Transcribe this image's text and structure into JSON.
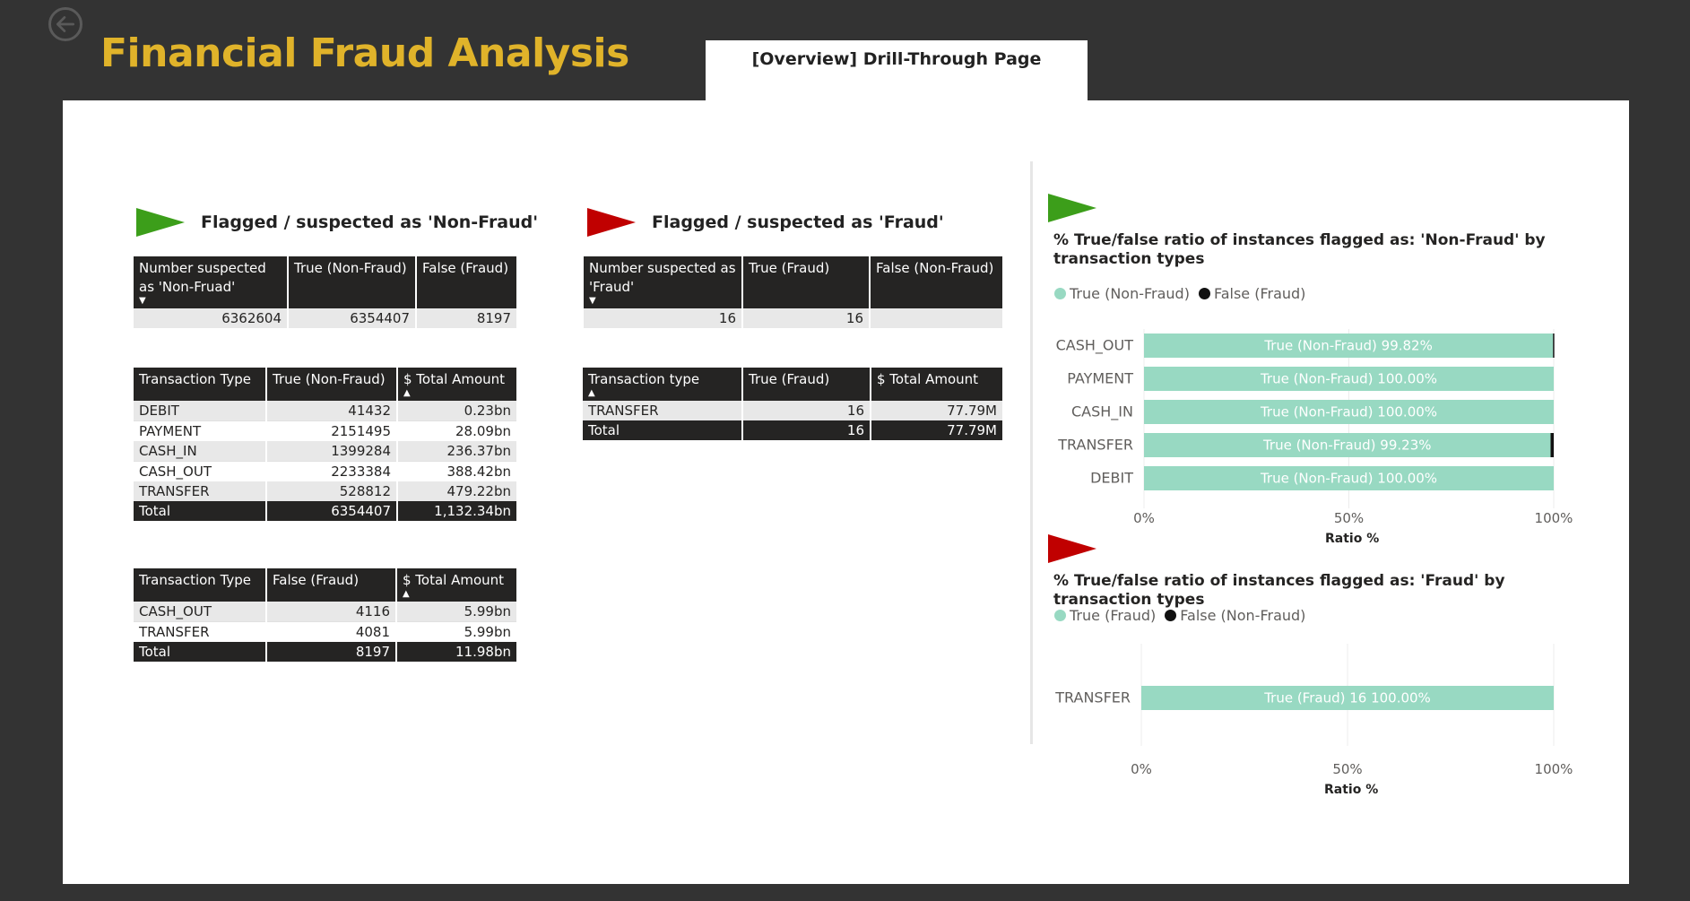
{
  "header": {
    "title": "Financial Fraud Analysis",
    "tab_label": "[Overview] Drill-Through Page"
  },
  "non_fraud": {
    "section_title": "Flagged / suspected as 'Non-Fraud'",
    "summary": {
      "headers": [
        "Number suspected as 'Non-Fruad'",
        "True (Non-Fraud)",
        "False (Fraud)"
      ],
      "row": [
        "6362604",
        "6354407",
        "8197"
      ]
    },
    "by_type": {
      "headers": [
        "Transaction Type",
        "True (Non-Fraud)",
        "$ Total Amount"
      ],
      "rows": [
        [
          "DEBIT",
          "41432",
          "0.23bn"
        ],
        [
          "PAYMENT",
          "2151495",
          "28.09bn"
        ],
        [
          "CASH_IN",
          "1399284",
          "236.37bn"
        ],
        [
          "CASH_OUT",
          "2233384",
          "388.42bn"
        ],
        [
          "TRANSFER",
          "528812",
          "479.22bn"
        ]
      ],
      "total": [
        "Total",
        "6354407",
        "1,132.34bn"
      ]
    },
    "false_by_type": {
      "headers": [
        "Transaction Type",
        "False (Fraud)",
        "$ Total Amount"
      ],
      "rows": [
        [
          "CASH_OUT",
          "4116",
          "5.99bn"
        ],
        [
          "TRANSFER",
          "4081",
          "5.99bn"
        ]
      ],
      "total": [
        "Total",
        "8197",
        "11.98bn"
      ]
    }
  },
  "fraud": {
    "section_title": "Flagged / suspected as 'Fraud'",
    "summary": {
      "headers": [
        "Number suspected as 'Fraud'",
        "True (Fraud)",
        "False (Non-Fraud)"
      ],
      "row": [
        "16",
        "16",
        ""
      ]
    },
    "by_type": {
      "headers": [
        "Transaction type",
        "True (Fraud)",
        "$ Total Amount"
      ],
      "rows": [
        [
          "TRANSFER",
          "16",
          "77.79M"
        ]
      ],
      "total": [
        "Total",
        "16",
        "77.79M"
      ]
    }
  },
  "colors": {
    "title": "#E0B32A",
    "green_flag": "#3C9E1A",
    "red_flag": "#C00000",
    "bar_true": "#98D9C2",
    "bar_false": "#111111",
    "table_header": "#252423"
  },
  "chart_data": [
    {
      "type": "bar",
      "orientation": "horizontal",
      "stacked": "100%",
      "title": "% True/false ratio of instances flagged as: 'Non-Fraud' by transaction types",
      "legend": [
        "True (Non-Fraud)",
        "False (Fraud)"
      ],
      "categories": [
        "CASH_OUT",
        "PAYMENT",
        "CASH_IN",
        "TRANSFER",
        "DEBIT"
      ],
      "series": [
        {
          "name": "True (Non-Fraud)",
          "values": [
            99.82,
            100.0,
            100.0,
            99.23,
            100.0
          ]
        },
        {
          "name": "False (Fraud)",
          "values": [
            0.18,
            0.0,
            0.0,
            0.77,
            0.0
          ]
        }
      ],
      "data_labels": [
        "True (Non-Fraud) 99.82%",
        "True (Non-Fraud) 100.00%",
        "True (Non-Fraud) 100.00%",
        "True (Non-Fraud) 99.23%",
        "True (Non-Fraud) 100.00%"
      ],
      "x_ticks": [
        "0%",
        "50%",
        "100%"
      ],
      "xlabel": "Ratio %",
      "xlim": [
        0,
        100
      ]
    },
    {
      "type": "bar",
      "orientation": "horizontal",
      "stacked": "100%",
      "title": "% True/false ratio of instances flagged as: 'Fraud' by transaction types",
      "legend": [
        "True (Fraud)",
        "False (Non-Fraud)"
      ],
      "categories": [
        "TRANSFER"
      ],
      "series": [
        {
          "name": "True (Fraud)",
          "values": [
            100.0
          ]
        },
        {
          "name": "False (Non-Fraud)",
          "values": [
            0.0
          ]
        }
      ],
      "data_labels": [
        "True (Fraud) 16 100.00%"
      ],
      "x_ticks": [
        "0%",
        "50%",
        "100%"
      ],
      "xlabel": "Ratio %",
      "xlim": [
        0,
        100
      ]
    }
  ]
}
